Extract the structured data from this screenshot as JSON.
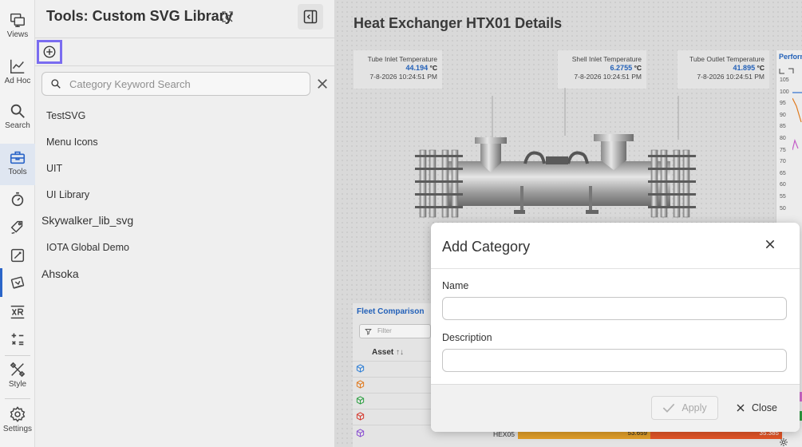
{
  "rail": {
    "items": [
      {
        "label": "Views",
        "icon": "views-icon"
      },
      {
        "label": "Ad Hoc",
        "icon": "adhoc-chart-icon"
      },
      {
        "label": "Search",
        "icon": "search-icon"
      },
      {
        "label": "Tools",
        "icon": "toolbox-icon"
      },
      {
        "label": "",
        "icon": "timer-icon"
      },
      {
        "label": "",
        "icon": "tag-edit-icon"
      },
      {
        "label": "",
        "icon": "image-edit-icon"
      },
      {
        "label": "",
        "icon": "svg-library-icon"
      },
      {
        "label": "",
        "icon": "xr-icon"
      },
      {
        "label": "",
        "icon": "calculator-icon"
      },
      {
        "label": "Style",
        "icon": "style-icon"
      },
      {
        "label": "Settings",
        "icon": "settings-icon"
      }
    ],
    "active": "Tools",
    "accent": "#2b65c8"
  },
  "panel": {
    "title": "Tools: Custom SVG Library",
    "search_placeholder": "Category Keyword Search",
    "categories": [
      {
        "label": "TestSVG"
      },
      {
        "label": "Menu Icons"
      },
      {
        "label": "UIT"
      },
      {
        "label": "UI Library"
      },
      {
        "label": "Skywalker_lib_svg"
      },
      {
        "label": "IOTA Global Demo"
      },
      {
        "label": "Ahsoka"
      }
    ],
    "add_button_highlight": "#7a6cf0"
  },
  "main": {
    "title": "Heat Exchanger HTX01 Details",
    "sensors": [
      {
        "label": "Tube Inlet Temperature",
        "value": "44.194",
        "unit": "°C",
        "time": "7-8-2026 10:24:51 PM"
      },
      {
        "label": "Shell Inlet Temperature",
        "value": "6.2755",
        "unit": "°C",
        "time": "7-8-2026 10:24:51 PM"
      },
      {
        "label": "Tube Outlet Temperature",
        "value": "41.895",
        "unit": "°C",
        "time": "7-8-2026 10:24:51 PM"
      }
    ],
    "performance": {
      "title": "Performance",
      "ticks": [
        "105",
        "100",
        "95",
        "90",
        "85",
        "80",
        "75",
        "70",
        "65",
        "60",
        "55",
        "50"
      ]
    },
    "fleet": {
      "title": "Fleet Comparison",
      "filter_placeholder": "Filter",
      "column": "Asset",
      "icon_colors": [
        "#2f7fd6",
        "#e07a1e",
        "#2ea043",
        "#d63a2f",
        "#8a4fd1"
      ],
      "last_row": {
        "name": "HEX05",
        "value_a": "53.659",
        "value_b": "35.385"
      }
    }
  },
  "modal": {
    "title": "Add Category",
    "name_label": "Name",
    "name_value": "",
    "description_label": "Description",
    "description_value": "",
    "apply_label": "Apply",
    "close_label": "Close"
  }
}
